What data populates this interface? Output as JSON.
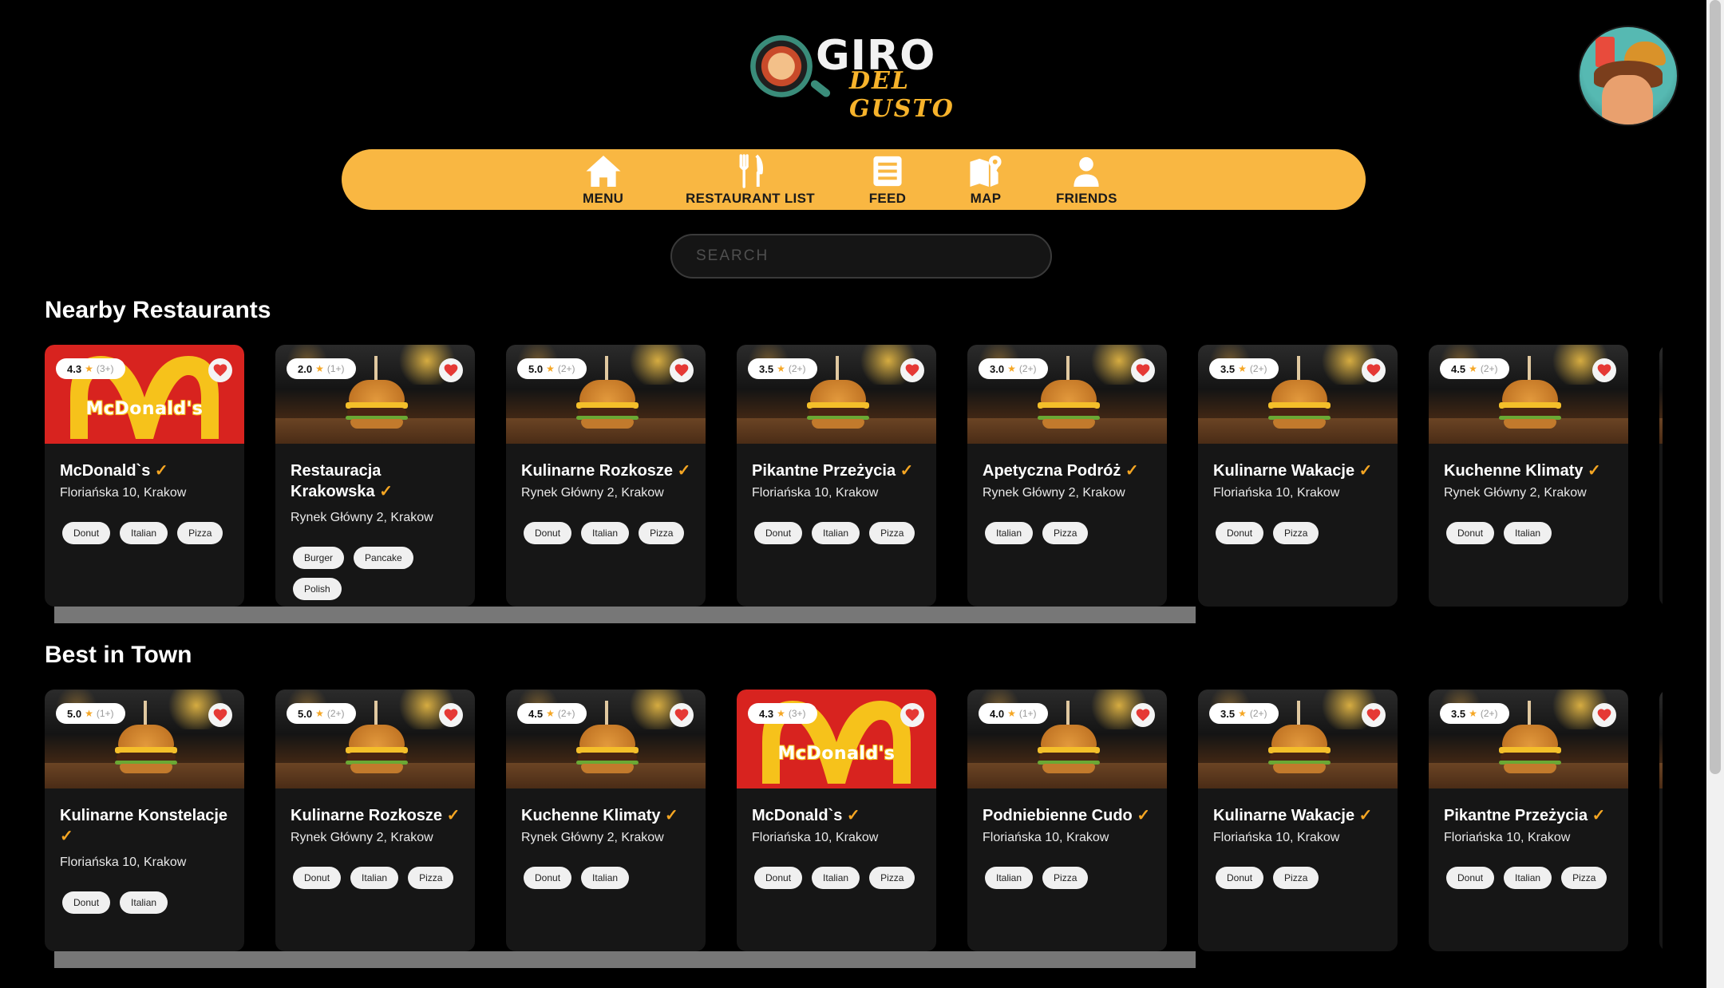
{
  "header": {
    "logo_word1": "GIRO",
    "logo_word2": "DEL GUSTO"
  },
  "nav": {
    "items": [
      {
        "label": "MENU",
        "icon": "home-icon"
      },
      {
        "label": "RESTAURANT LIST",
        "icon": "fork-knife-icon"
      },
      {
        "label": "FEED",
        "icon": "feed-icon"
      },
      {
        "label": "MAP",
        "icon": "map-icon"
      },
      {
        "label": "FRIENDS",
        "icon": "person-icon"
      }
    ]
  },
  "search": {
    "placeholder": "SEARCH"
  },
  "colors": {
    "accent": "#f9b742",
    "check": "#f5a623",
    "heart": "#e53935",
    "background": "#000000",
    "card": "#161616"
  },
  "sections": [
    {
      "title": "Nearby Restaurants",
      "cards": [
        {
          "rating": "4.3",
          "count": "(3+)",
          "image": "mcdonalds-logo",
          "name": "McDonald`s",
          "address": "Floriańska 10, Krakow",
          "tags": [
            "Donut",
            "Italian",
            "Pizza"
          ]
        },
        {
          "rating": "2.0",
          "count": "(1+)",
          "image": "burger",
          "name": "Restauracja Krakowska",
          "address": "Rynek Główny 2, Krakow",
          "tags": [
            "Burger",
            "Pancake",
            "Polish"
          ]
        },
        {
          "rating": "5.0",
          "count": "(2+)",
          "image": "burger",
          "name": "Kulinarne Rozkosze",
          "address": "Rynek Główny 2, Krakow",
          "tags": [
            "Donut",
            "Italian",
            "Pizza"
          ]
        },
        {
          "rating": "3.5",
          "count": "(2+)",
          "image": "burger",
          "name": "Pikantne Przeżycia",
          "address": "Floriańska 10, Krakow",
          "tags": [
            "Donut",
            "Italian",
            "Pizza"
          ]
        },
        {
          "rating": "3.0",
          "count": "(2+)",
          "image": "burger",
          "name": "Apetyczna Podróż",
          "address": "Rynek Główny 2, Krakow",
          "tags": [
            "Italian",
            "Pizza"
          ]
        },
        {
          "rating": "3.5",
          "count": "(2+)",
          "image": "burger",
          "name": "Kulinarne Wakacje",
          "address": "Floriańska 10, Krakow",
          "tags": [
            "Donut",
            "Pizza"
          ]
        },
        {
          "rating": "4.5",
          "count": "(2+)",
          "image": "burger",
          "name": "Kuchenne Klimaty",
          "address": "Rynek Główny 2, Krakow",
          "tags": [
            "Donut",
            "Italian"
          ]
        }
      ]
    },
    {
      "title": "Best in Town",
      "cards": [
        {
          "rating": "5.0",
          "count": "(1+)",
          "image": "burger",
          "name": "Kulinarne Konstelacje",
          "address": "Floriańska 10, Krakow",
          "tags": [
            "Donut",
            "Italian"
          ]
        },
        {
          "rating": "5.0",
          "count": "(2+)",
          "image": "burger",
          "name": "Kulinarne Rozkosze",
          "address": "Rynek Główny 2, Krakow",
          "tags": [
            "Donut",
            "Italian",
            "Pizza"
          ]
        },
        {
          "rating": "4.5",
          "count": "(2+)",
          "image": "burger",
          "name": "Kuchenne Klimaty",
          "address": "Rynek Główny 2, Krakow",
          "tags": [
            "Donut",
            "Italian"
          ]
        },
        {
          "rating": "4.3",
          "count": "(3+)",
          "image": "mcdonalds-logo",
          "name": "McDonald`s",
          "address": "Floriańska 10, Krakow",
          "tags": [
            "Donut",
            "Italian",
            "Pizza"
          ]
        },
        {
          "rating": "4.0",
          "count": "(1+)",
          "image": "burger",
          "name": "Podniebienne Cudo",
          "address": "Floriańska 10, Krakow",
          "tags": [
            "Italian",
            "Pizza"
          ]
        },
        {
          "rating": "3.5",
          "count": "(2+)",
          "image": "burger",
          "name": "Kulinarne Wakacje",
          "address": "Floriańska 10, Krakow",
          "tags": [
            "Donut",
            "Pizza"
          ]
        },
        {
          "rating": "3.5",
          "count": "(2+)",
          "image": "burger",
          "name": "Pikantne Przeżycia",
          "address": "Floriańska 10, Krakow",
          "tags": [
            "Donut",
            "Italian",
            "Pizza"
          ]
        }
      ]
    }
  ],
  "mcd_text": "McDonald's"
}
